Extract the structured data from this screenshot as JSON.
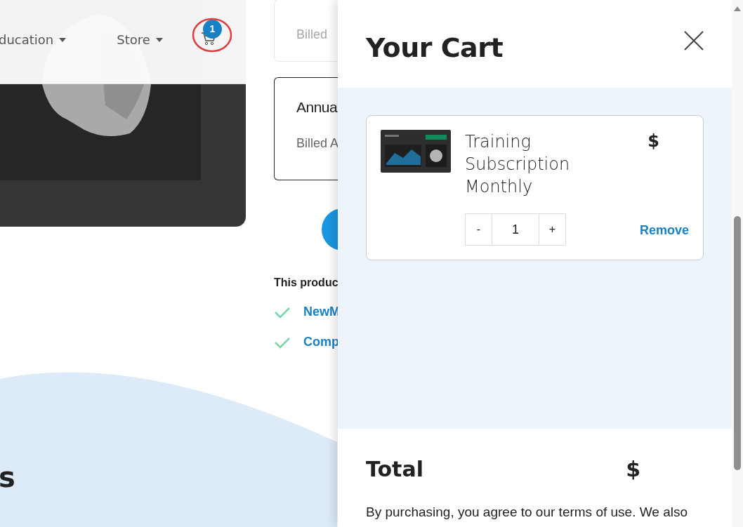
{
  "nav": {
    "items": [
      {
        "label": "ducation",
        "dropdown": true
      },
      {
        "label": "Store",
        "dropdown": true
      }
    ],
    "cart_count": "1",
    "highlight_ring": true
  },
  "page": {
    "plans": [
      {
        "billing": "Billed",
        "selected": false
      },
      {
        "title": "Annua",
        "billing": "Billed A",
        "selected": true
      }
    ],
    "includes_heading": "This produc",
    "includes": [
      "NewM",
      "Comp"
    ],
    "section_heading": "s"
  },
  "cart": {
    "title": "Your Cart",
    "items": [
      {
        "name": "Training Subscription Monthly",
        "price": "$",
        "quantity": "1",
        "decrement": "-",
        "increment": "+",
        "remove": "Remove"
      }
    ],
    "total_label": "Total",
    "total_value": "$",
    "notice": "By purchasing, you agree to our terms of use. We also"
  }
}
